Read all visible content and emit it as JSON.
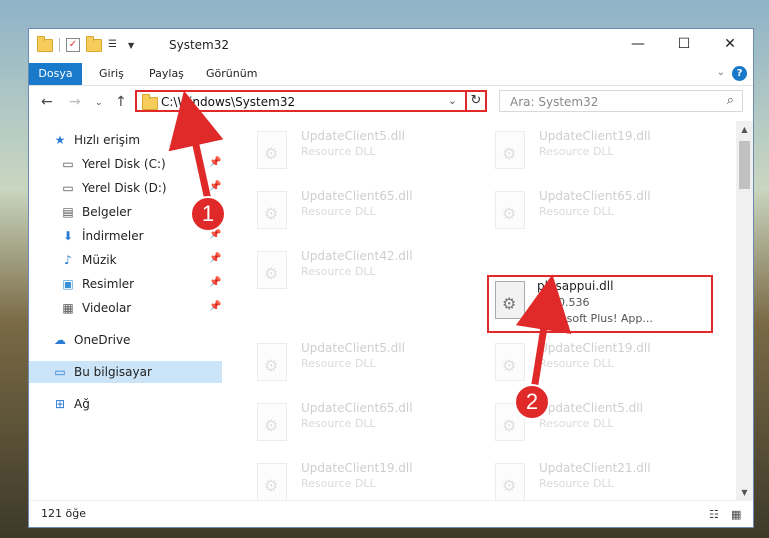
{
  "window": {
    "title": "System32"
  },
  "ribbon": {
    "tabs": [
      "Dosya",
      "Giriş",
      "Paylaş",
      "Görünüm"
    ]
  },
  "address": {
    "path": "C:\\Windows\\System32"
  },
  "search": {
    "placeholder": "Ara: System32"
  },
  "nav": {
    "items": [
      {
        "label": "Hızlı erişim",
        "icon": "star-icon"
      },
      {
        "label": "Yerel Disk (C:)",
        "icon": "drive-icon"
      },
      {
        "label": "Yerel Disk (D:)",
        "icon": "drive-icon"
      },
      {
        "label": "Belgeler",
        "icon": "documents-icon"
      },
      {
        "label": "İndirmeler",
        "icon": "download-icon"
      },
      {
        "label": "Müzik",
        "icon": "music-icon"
      },
      {
        "label": "Resimler",
        "icon": "pictures-icon"
      },
      {
        "label": "Videolar",
        "icon": "videos-icon"
      },
      {
        "label": "OneDrive",
        "icon": "cloud-icon"
      },
      {
        "label": "Bu bilgisayar",
        "icon": "computer-icon"
      },
      {
        "label": "Ağ",
        "icon": "network-icon"
      }
    ]
  },
  "files": [
    {
      "name": "UpdateClient5.dll",
      "desc": "Resource DLL"
    },
    {
      "name": "UpdateClient19.dll",
      "desc": "Resource DLL"
    },
    {
      "name": "UpdateClient65.dll",
      "desc": "Resource DLL"
    },
    {
      "name": "UpdateClient65.dll",
      "desc": "Resource DLL"
    },
    {
      "name": "UpdateClient42.dll",
      "desc": "Resource DLL"
    },
    {
      "name": "plusappui.dll",
      "desc": "1.0.0.536",
      "desc2": "Microsoft Plus! App..."
    },
    {
      "name": "UpdateClient5.dll",
      "desc": "Resource DLL"
    },
    {
      "name": "UpdateClient19.dll",
      "desc": "Resource DLL"
    },
    {
      "name": "UpdateClient65.dll",
      "desc": "Resource DLL"
    },
    {
      "name": "UpdateClient5.dll",
      "desc": "Resource DLL"
    },
    {
      "name": "UpdateClient19.dll",
      "desc": "Resource DLL"
    },
    {
      "name": "UpdateClient21.dll",
      "desc": "Resource DLL"
    }
  ],
  "status": {
    "count": "121 öğe"
  },
  "annotations": {
    "step1": "1",
    "step2": "2",
    "color": "#e02a2a"
  }
}
